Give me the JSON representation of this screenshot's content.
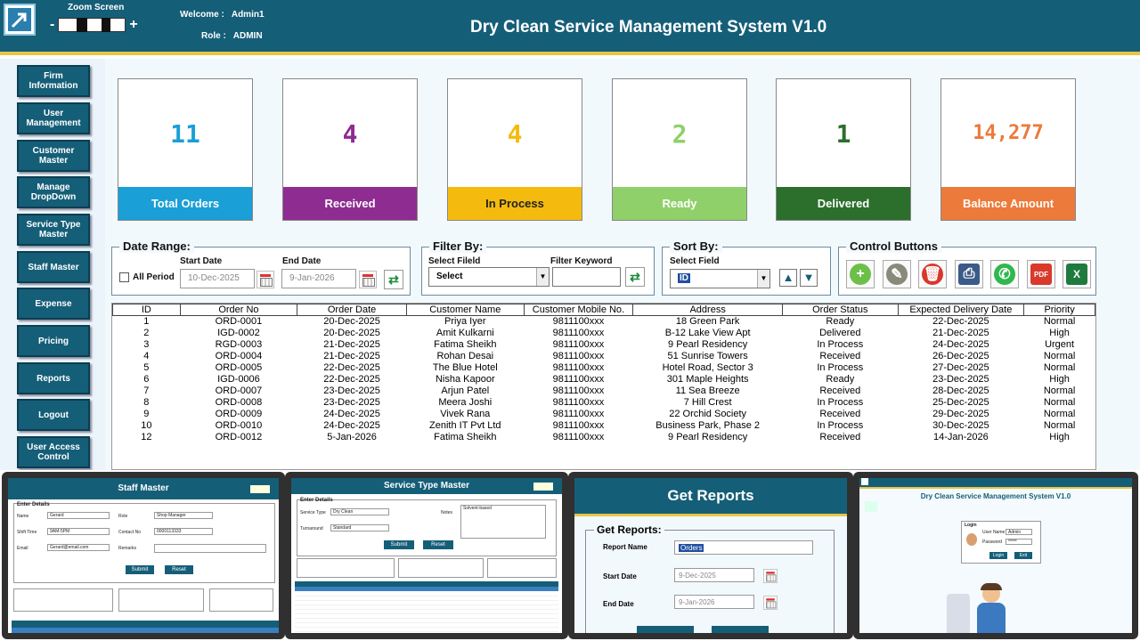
{
  "header": {
    "title": "Dry Clean Service Management System V1.0",
    "zoom_label": "Zoom Screen",
    "zoom_minus": "-",
    "zoom_plus": "+",
    "welcome_label": "Welcome :",
    "welcome_user": "Admin1",
    "role_label": "Role :",
    "role_value": "ADMIN"
  },
  "sidebar": [
    "Firm Information",
    "User Management",
    "Customer Master",
    "Manage DropDown",
    "Service Type Master",
    "Staff Master",
    "Expense",
    "Pricing",
    "Reports",
    "Logout",
    "User Access Control"
  ],
  "cards": [
    {
      "label": "Total Orders",
      "value": "11",
      "color": "#1a9fd6"
    },
    {
      "label": "Received",
      "value": "4",
      "color": "#8e2c91"
    },
    {
      "label": "In Process",
      "value": "4",
      "color": "#f4bb0e"
    },
    {
      "label": "Ready",
      "value": "2",
      "color": "#8fd06a"
    },
    {
      "label": "Delivered",
      "value": "1",
      "color": "#2c6e2c"
    },
    {
      "label": "Balance Amount",
      "value": "14,277",
      "color": "#ec7a3a"
    }
  ],
  "date_range": {
    "title": "Date Range:",
    "start_label": "Start Date",
    "end_label": "End Date",
    "all_period": "All Period",
    "start": "10-Dec-2025",
    "end": "9-Jan-2026"
  },
  "filter": {
    "title": "Filter By:",
    "field_label": "Select Fileld",
    "keyword_label": "Filter Keyword",
    "field_value": "Select",
    "keyword": ""
  },
  "sort": {
    "title": "Sort By:",
    "field_label": "Select Field",
    "field_value": "ID"
  },
  "controls": {
    "title": "Control Buttons"
  },
  "table": {
    "headers": [
      "ID",
      "Order No",
      "Order Date",
      "Customer Name",
      "Customer Mobile No.",
      "Address",
      "Order Status",
      "Expected Delivery Date",
      "Priority"
    ],
    "rows": [
      [
        "1",
        "ORD-0001",
        "20-Dec-2025",
        "Priya Iyer",
        "9811100xxx",
        "18 Green Park",
        "Ready",
        "22-Dec-2025",
        "Normal"
      ],
      [
        "2",
        "IGD-0002",
        "20-Dec-2025",
        "Amit Kulkarni",
        "9811100xxx",
        "B-12 Lake View Apt",
        "Delivered",
        "21-Dec-2025",
        "High"
      ],
      [
        "3",
        "RGD-0003",
        "21-Dec-2025",
        "Fatima Sheikh",
        "9811100xxx",
        "9 Pearl Residency",
        "In Process",
        "24-Dec-2025",
        "Urgent"
      ],
      [
        "4",
        "ORD-0004",
        "21-Dec-2025",
        "Rohan Desai",
        "9811100xxx",
        "51 Sunrise Towers",
        "Received",
        "26-Dec-2025",
        "Normal"
      ],
      [
        "5",
        "ORD-0005",
        "22-Dec-2025",
        "The Blue Hotel",
        "9811100xxx",
        "Hotel Road, Sector 3",
        "In Process",
        "27-Dec-2025",
        "Normal"
      ],
      [
        "6",
        "IGD-0006",
        "22-Dec-2025",
        "Nisha Kapoor",
        "9811100xxx",
        "301 Maple Heights",
        "Ready",
        "23-Dec-2025",
        "High"
      ],
      [
        "7",
        "ORD-0007",
        "23-Dec-2025",
        "Arjun Patel",
        "9811100xxx",
        "11 Sea Breeze",
        "Received",
        "28-Dec-2025",
        "Normal"
      ],
      [
        "8",
        "ORD-0008",
        "23-Dec-2025",
        "Meera Joshi",
        "9811100xxx",
        "7 Hill Crest",
        "In Process",
        "25-Dec-2025",
        "Normal"
      ],
      [
        "9",
        "ORD-0009",
        "24-Dec-2025",
        "Vivek Rana",
        "9811100xxx",
        "22 Orchid Society",
        "Received",
        "29-Dec-2025",
        "Normal"
      ],
      [
        "10",
        "ORD-0010",
        "24-Dec-2025",
        "Zenith IT Pvt Ltd",
        "9811100xxx",
        "Business Park, Phase 2",
        "In Process",
        "30-Dec-2025",
        "Normal"
      ],
      [
        "12",
        "ORD-0012",
        "5-Jan-2026",
        "Fatima Sheikh",
        "9811100xxx",
        "9 Pearl Residency",
        "Received",
        "14-Jan-2026",
        "High"
      ]
    ]
  },
  "thumbs": {
    "staff": {
      "title": "Staff Master",
      "section": "Enter Details",
      "name_label": "Name",
      "name": "Gerard",
      "role_label": "Role",
      "role": "Shop Manager",
      "shift_label": "Shift Time",
      "shift": "9AM-5PM",
      "contact_label": "Contact No",
      "contact": "0000113333",
      "email_label": "Email",
      "email": "Gerard@email.com",
      "remarks_label": "Remarks",
      "submit": "Submit",
      "reset": "Reset"
    },
    "service": {
      "title": "Service Type Master",
      "section": "Enter Details",
      "type_label": "Service Type",
      "type": "Dry Clean",
      "notes_label": "Notes",
      "notes": "Solvent-based",
      "turn_label": "Turnaround",
      "turn": "Standard",
      "submit": "Submit",
      "reset": "Reset"
    },
    "reports": {
      "title": "Get Reports",
      "section": "Get Reports:",
      "name_label": "Report Name",
      "name": "Orders",
      "start_label": "Start Date",
      "start": "9-Dec-2025",
      "end_label": "End Date",
      "end": "9-Jan-2026"
    },
    "login": {
      "title": "Dry Clean Service Management System V1.0",
      "section": "Login",
      "user_label": "User Name",
      "user": "Admin",
      "pass_label": "Password",
      "pass": "*****",
      "login_btn": "Login",
      "exit_btn": "Exit"
    }
  }
}
